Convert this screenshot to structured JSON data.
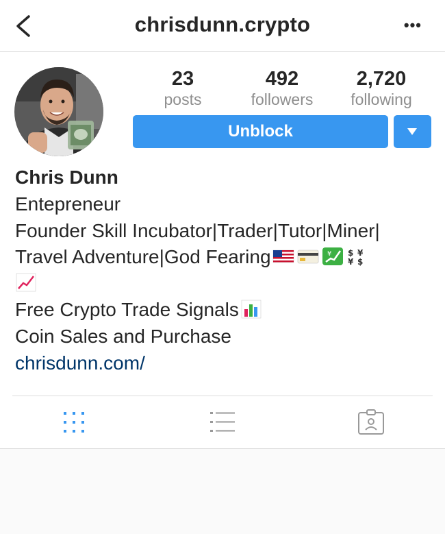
{
  "header": {
    "username": "chrisdunn.crypto",
    "back_icon": "chevron-left-icon",
    "more_label": "•••"
  },
  "stats": [
    {
      "value": "23",
      "label": "posts"
    },
    {
      "value": "492",
      "label": "followers"
    },
    {
      "value": "2,720",
      "label": "following"
    }
  ],
  "actions": {
    "unblock_label": "Unblock"
  },
  "bio": {
    "name": "Chris Dunn",
    "line1": "Entepreneur",
    "line2": "Founder Skill Incubator|Trader|Tutor|Miner|",
    "line3": "Travel Adventure|God Fearing",
    "line5": "Free Crypto Trade Signals",
    "line6": "Coin Sales and Purchase",
    "link": "chrisdunn.com/"
  },
  "tabs": [
    "grid-icon",
    "list-icon",
    "tagged-icon"
  ],
  "colors": {
    "accent": "#3897f0",
    "link": "#003569",
    "divider": "#dbdbdb"
  }
}
